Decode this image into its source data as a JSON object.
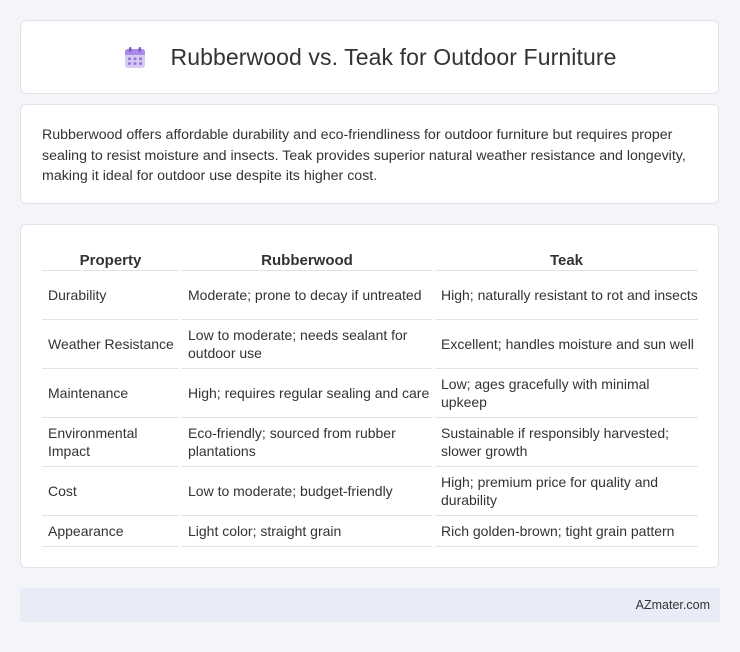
{
  "header": {
    "title": "Rubberwood vs. Teak for Outdoor Furniture",
    "icon": "calendar-icon"
  },
  "summary": {
    "text": "Rubberwood offers affordable durability and eco-friendliness for outdoor furniture but requires proper sealing to resist moisture and insects. Teak provides superior natural weather resistance and longevity, making it ideal for outdoor use despite its higher cost."
  },
  "table": {
    "headers": [
      "Property",
      "Rubberwood",
      "Teak"
    ],
    "rows": [
      [
        "Durability",
        "Moderate; prone to decay if untreated",
        "High; naturally resistant to rot and insects"
      ],
      [
        "Weather Resistance",
        "Low to moderate; needs sealant for outdoor use",
        "Excellent; handles moisture and sun well"
      ],
      [
        "Maintenance",
        "High; requires regular sealing and care",
        "Low; ages gracefully with minimal upkeep"
      ],
      [
        "Environmental Impact",
        "Eco-friendly; sourced from rubber plantations",
        "Sustainable if responsibly harvested; slower growth"
      ],
      [
        "Cost",
        "Low to moderate; budget-friendly",
        "High; premium price for quality and durability"
      ],
      [
        "Appearance",
        "Light color; straight grain",
        "Rich golden-brown; tight grain pattern"
      ]
    ]
  },
  "footer": {
    "brand": "AZmater.com"
  }
}
